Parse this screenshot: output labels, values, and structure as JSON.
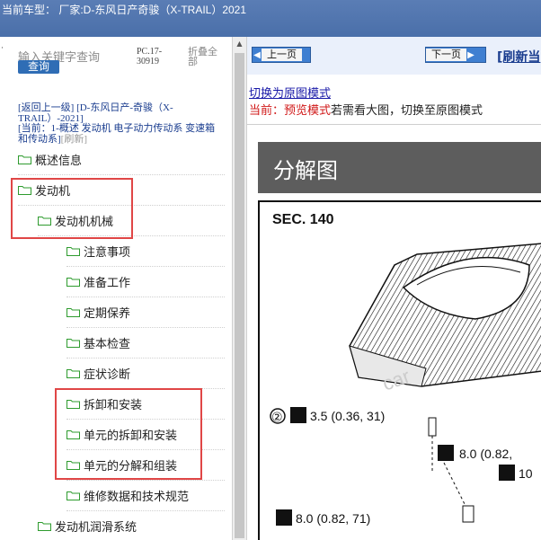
{
  "header": {
    "title": "当前车型： 厂家:D-东风日产奇骏（X-TRAIL）2021"
  },
  "sidebar": {
    "search_placeholder": "输入关键字查询",
    "search_button": "查询",
    "code": "PC.17-30919",
    "collapse_all": "折叠全部",
    "back_link": "[返回上一级]",
    "back_target": "[D-东风日产-奇骏（X-TRAIL）-2021]",
    "current_label": "[当前：1-概述 发动机 电子动力传动系 变速箱和传动系]",
    "refresh": "[刷新]",
    "items": [
      {
        "label": "概述信息"
      },
      {
        "label": "发动机"
      },
      {
        "label": "发动机机械"
      },
      {
        "label": "注意事项"
      },
      {
        "label": "准备工作"
      },
      {
        "label": "定期保养"
      },
      {
        "label": "基本检查"
      },
      {
        "label": "症状诊断"
      },
      {
        "label": "拆卸和安装"
      },
      {
        "label": "单元的拆卸和安装"
      },
      {
        "label": "单元的分解和组装"
      },
      {
        "label": "维修数据和技术规范"
      },
      {
        "label": "发动机润滑系统"
      }
    ]
  },
  "content": {
    "prev_button": "上一页",
    "next_button": "下一页",
    "refresh_link": "[刷新当",
    "switch_link": "切换为原图模式",
    "status_prefix": "当前：预览模式",
    "status_suffix": "若需看大图，切换至原图模式",
    "section_title": "分解图",
    "sec_label": "SEC. 140",
    "callout_num": "②",
    "torque_1": "3.5 (0.36, 31)",
    "torque_2": "8.0 (0.82,",
    "torque_3": "10",
    "torque_4": "8.0 (0.82, 71)",
    "watermark": "car"
  },
  "colors": {
    "header_bg": "#4a6fa9",
    "highlight_border": "#e04646",
    "link": "#1a3d8f",
    "status_red": "#d01818"
  }
}
